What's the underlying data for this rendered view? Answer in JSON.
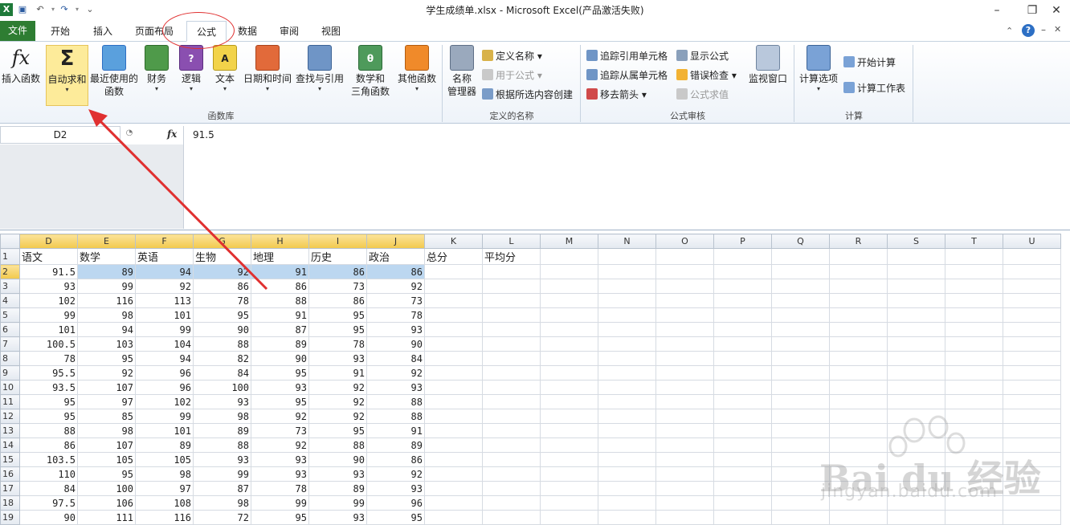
{
  "window": {
    "title": "学生成绩单.xlsx - Microsoft Excel(产品激活失败)",
    "controls": {
      "minimize": "–",
      "restore": "❐",
      "close": "✕"
    }
  },
  "tabs": [
    {
      "label": "文件",
      "active": false
    },
    {
      "label": "开始",
      "active": false
    },
    {
      "label": "插入",
      "active": false
    },
    {
      "label": "页面布局",
      "active": false
    },
    {
      "label": "公式",
      "active": true
    },
    {
      "label": "数据",
      "active": false
    },
    {
      "label": "审阅",
      "active": false
    },
    {
      "label": "视图",
      "active": false
    }
  ],
  "ribbon": {
    "function_library": {
      "group_label": "函数库",
      "insert_function": {
        "icon": "fx",
        "label": "插入函数"
      },
      "autosum": {
        "icon": "Σ",
        "label": "自动求和"
      },
      "recent": {
        "line1": "最近使用的",
        "line2": "函数"
      },
      "finance": {
        "label": "财务"
      },
      "logic": {
        "label": "逻辑"
      },
      "text": {
        "label": "文本"
      },
      "datetime": {
        "label": "日期和时间"
      },
      "lookup": {
        "label": "查找与引用"
      },
      "math": {
        "icon": "θ",
        "line1": "数学和",
        "line2": "三角函数"
      },
      "other": {
        "label": "其他函数"
      }
    },
    "defined_names": {
      "group_label": "定义的名称",
      "name_manager": {
        "line1": "名称",
        "line2": "管理器"
      },
      "define_name": "定义名称",
      "use_in_formula": "用于公式",
      "create_from_selection": "根据所选内容创建"
    },
    "formula_auditing": {
      "group_label": "公式审核",
      "trace_precedents": "追踪引用单元格",
      "trace_dependents": "追踪从属单元格",
      "remove_arrows": "移去箭头",
      "show_formulas": "显示公式",
      "error_checking": "错误检查",
      "evaluate_formula": "公式求值",
      "watch_window": "监视窗口"
    },
    "calculation": {
      "group_label": "计算",
      "calc_options": "计算选项",
      "calc_now": "开始计算",
      "calc_sheet": "计算工作表"
    }
  },
  "name_box": "D2",
  "fx_label": "fx",
  "formula_value": "91.5",
  "sheet": {
    "columns": [
      "D",
      "E",
      "F",
      "G",
      "H",
      "I",
      "J",
      "K",
      "L",
      "M",
      "N",
      "O",
      "P",
      "Q",
      "R",
      "S",
      "T",
      "U"
    ],
    "selected_columns": [
      "D",
      "E",
      "F",
      "G",
      "H",
      "I",
      "J"
    ],
    "rows": [
      {
        "n": "1",
        "cells": [
          "语文",
          "数学",
          "英语",
          "生物",
          "地理",
          "历史",
          "政治",
          "总分",
          "平均分"
        ]
      },
      {
        "n": "2",
        "cells": [
          "91.5",
          "89",
          "94",
          "92",
          "91",
          "86",
          "86"
        ]
      },
      {
        "n": "3",
        "cells": [
          "93",
          "99",
          "92",
          "86",
          "86",
          "73",
          "92"
        ]
      },
      {
        "n": "4",
        "cells": [
          "102",
          "116",
          "113",
          "78",
          "88",
          "86",
          "73"
        ]
      },
      {
        "n": "5",
        "cells": [
          "99",
          "98",
          "101",
          "95",
          "91",
          "95",
          "78"
        ]
      },
      {
        "n": "6",
        "cells": [
          "101",
          "94",
          "99",
          "90",
          "87",
          "95",
          "93"
        ]
      },
      {
        "n": "7",
        "cells": [
          "100.5",
          "103",
          "104",
          "88",
          "89",
          "78",
          "90"
        ]
      },
      {
        "n": "8",
        "cells": [
          "78",
          "95",
          "94",
          "82",
          "90",
          "93",
          "84"
        ]
      },
      {
        "n": "9",
        "cells": [
          "95.5",
          "92",
          "96",
          "84",
          "95",
          "91",
          "92"
        ]
      },
      {
        "n": "10",
        "cells": [
          "93.5",
          "107",
          "96",
          "100",
          "93",
          "92",
          "93"
        ]
      },
      {
        "n": "11",
        "cells": [
          "95",
          "97",
          "102",
          "93",
          "95",
          "92",
          "88"
        ]
      },
      {
        "n": "12",
        "cells": [
          "95",
          "85",
          "99",
          "98",
          "92",
          "92",
          "88"
        ]
      },
      {
        "n": "13",
        "cells": [
          "88",
          "98",
          "101",
          "89",
          "73",
          "95",
          "91"
        ]
      },
      {
        "n": "14",
        "cells": [
          "86",
          "107",
          "89",
          "88",
          "92",
          "88",
          "89"
        ]
      },
      {
        "n": "15",
        "cells": [
          "103.5",
          "105",
          "105",
          "93",
          "93",
          "90",
          "86"
        ]
      },
      {
        "n": "16",
        "cells": [
          "110",
          "95",
          "98",
          "99",
          "93",
          "93",
          "92"
        ]
      },
      {
        "n": "17",
        "cells": [
          "84",
          "100",
          "97",
          "87",
          "78",
          "89",
          "93"
        ]
      },
      {
        "n": "18",
        "cells": [
          "97.5",
          "106",
          "108",
          "98",
          "99",
          "99",
          "96"
        ]
      },
      {
        "n": "19",
        "cells": [
          "90",
          "111",
          "116",
          "72",
          "95",
          "93",
          "95"
        ]
      }
    ]
  },
  "watermark": {
    "brand": "Bai du 经验",
    "url": "jingyan.baidu.com"
  },
  "colors": {
    "file_tab": "#2e7d32",
    "annotation_red": "#e03030",
    "selection": "#bcd7f0",
    "autosum_highlight": "#fdeb9a"
  }
}
